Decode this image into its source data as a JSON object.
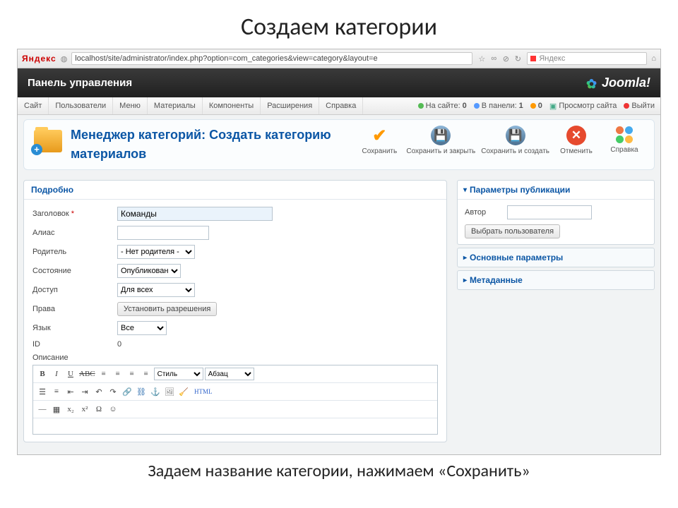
{
  "slide": {
    "title": "Создаем категории",
    "caption": "Задаем название категории, нажимаем «Сохранить»"
  },
  "browser": {
    "yandex_label": "Яндекс",
    "url": "localhost/site/administrator/index.php?option=com_categories&view=category&layout=e",
    "search_placeholder": "Яндекс"
  },
  "cp": {
    "title": "Панель управления",
    "logo": "Joomla!",
    "menu": [
      "Сайт",
      "Пользователи",
      "Меню",
      "Материалы",
      "Компоненты",
      "Расширения",
      "Справка"
    ],
    "status": {
      "onsite_label": "На сайте:",
      "onsite_val": "0",
      "panel_label": "В панели:",
      "panel_val": "1",
      "msg_val": "0",
      "preview": "Просмотр сайта",
      "logout": "Выйти"
    }
  },
  "toolbar": {
    "title_line1": "Менеджер категорий: Создать категорию",
    "title_line2": "материалов",
    "actions": {
      "save": "Сохранить",
      "save_close": "Сохранить и закрыть",
      "save_new": "Сохранить и создать",
      "cancel": "Отменить",
      "help": "Справка"
    }
  },
  "form": {
    "panel_title": "Подробно",
    "fields": {
      "title_label": "Заголовок",
      "title_value": "Команды",
      "alias_label": "Алиас",
      "alias_value": "",
      "parent_label": "Родитель",
      "parent_value": "- Нет родителя -",
      "state_label": "Состояние",
      "state_value": "Опубликовано",
      "access_label": "Доступ",
      "access_value": "Для всех",
      "perm_label": "Права",
      "perm_btn": "Установить разрешения",
      "lang_label": "Язык",
      "lang_value": "Все",
      "id_label": "ID",
      "id_value": "0",
      "desc_label": "Описание"
    }
  },
  "editor": {
    "style_sel": "Стиль",
    "para_sel": "Абзац",
    "html_label": "HTML"
  },
  "side": {
    "pub_title": "Параметры публикации",
    "author_label": "Автор",
    "author_value": "",
    "select_user": "Выбрать пользователя",
    "basic_title": "Основные параметры",
    "meta_title": "Метаданные"
  }
}
